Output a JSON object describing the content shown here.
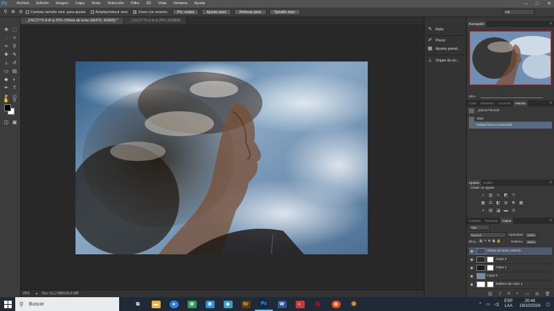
{
  "app": {
    "logo": "Ps"
  },
  "menu": [
    "Archivo",
    "Edición",
    "Imagen",
    "Capa",
    "Texto",
    "Selección",
    "Filtro",
    "3D",
    "Vista",
    "Ventana",
    "Ayuda"
  ],
  "window_controls": [
    "–",
    "□",
    "✕"
  ],
  "options": {
    "check1": "Cambiar tamaño vent. para ajustar",
    "check2": "Ampliar/reducir vent.",
    "check3": "Zoom con arrastre",
    "btn1": "Píx. reales",
    "btn2": "Ajustar pant.",
    "btn3": "Rellenar pant.",
    "btn4": "Tamaño impr.",
    "workspace": "esi"
  },
  "tabs": [
    "_DSC2775-8.tif al 25% (Viñeta de lente (AEP2), RGB/8) *",
    "_DSC2775-8.tif al 25% (RGB/8)"
  ],
  "status": {
    "zoom": "25%",
    "doc": "Doc: 51,2 MB/105,8 MB"
  },
  "dock": {
    "item1": "Rollo",
    "item2": "Pincel",
    "item3": "Ajustes preest...",
    "item4": "Orígen de clo..."
  },
  "navigator": {
    "tab": "Navegador",
    "zoom": "25%"
  },
  "history_tabs": [
    "Color",
    "Muestras",
    "Acciones",
    "Historia"
  ],
  "history": {
    "snapshot": "_DSC2775-8.tif",
    "step1": "Abrir",
    "step2": "Voltear lienzo horizontal"
  },
  "adjust_tabs": [
    "Ajustes",
    "Estilos"
  ],
  "adjust_title": "Añadir un ajuste",
  "layer_tabs": [
    "Canales",
    "Trazados",
    "Capas"
  ],
  "layers_panel": {
    "kind": "Tipo",
    "blend": "Normal",
    "opacity_label": "Opacidad:",
    "opacity": "100%",
    "lock_label": "Bloq.:",
    "fill_label": "Relleno:",
    "fill": "100%"
  },
  "layers": [
    {
      "name": "Viñeta de lente (AEP2)"
    },
    {
      "name": "Capa 2"
    },
    {
      "name": "Capa 1"
    },
    {
      "name": "Capa 3"
    },
    {
      "name": "Relleno de color 1"
    }
  ],
  "taskbar": {
    "search": "Buscar",
    "apps": [
      {
        "name": "task-view",
        "glyph": "⧉",
        "color": "#1f2a36"
      },
      {
        "name": "file-explorer",
        "glyph": "▬",
        "color": "#e8b83a"
      },
      {
        "name": "messenger",
        "glyph": "●",
        "color": "#2f7fe8"
      },
      {
        "name": "photos",
        "glyph": "✿",
        "color": "#2f9e58"
      },
      {
        "name": "calculator",
        "glyph": "⊞",
        "color": "#2d8fd2"
      },
      {
        "name": "tips",
        "glyph": "◆",
        "color": "#3aa0c8"
      },
      {
        "name": "bridge",
        "glyph": "Br",
        "color": "#5a3a10"
      },
      {
        "name": "photoshop",
        "glyph": "Ps",
        "color": "#0c2a4a"
      },
      {
        "name": "word",
        "glyph": "W",
        "color": "#2b579a"
      },
      {
        "name": "teams",
        "glyph": "◐",
        "color": "#c73b3b"
      },
      {
        "name": "netflix",
        "glyph": "N",
        "color": "#1f2a36"
      },
      {
        "name": "chrome",
        "glyph": "◉",
        "color": "#dd4a3a"
      },
      {
        "name": "settings",
        "glyph": "✹",
        "color": "#c8782c"
      }
    ]
  },
  "tray": {
    "lang1": "ESP",
    "lang2": "LAA",
    "time": "20:44",
    "date": "19/10/2024"
  }
}
